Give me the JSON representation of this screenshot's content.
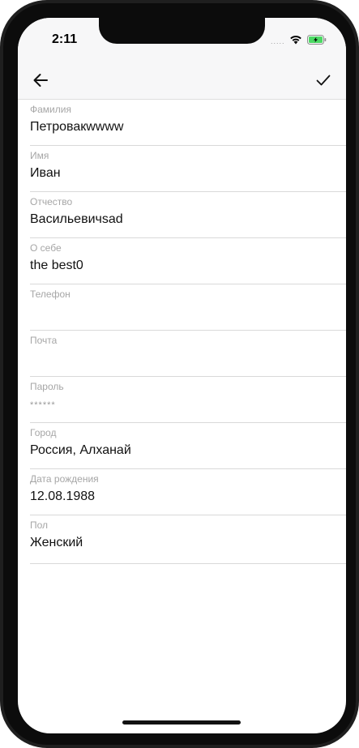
{
  "status_bar": {
    "time": "2:11",
    "signal_dots": "....."
  },
  "nav": {
    "back_icon": "arrow-left-icon",
    "confirm_icon": "checkmark-icon"
  },
  "fields": {
    "last_name": {
      "label": "Фамилия",
      "value": "Петровакwwww"
    },
    "first_name": {
      "label": "Имя",
      "value": "Иван"
    },
    "patronymic": {
      "label": "Отчество",
      "value": "Васильевичsad"
    },
    "about": {
      "label": "О себе",
      "value": "the best0"
    },
    "phone": {
      "label": "Телефон",
      "value": ""
    },
    "email": {
      "label": "Почта",
      "value": ""
    },
    "password": {
      "label": "Пароль",
      "value": "******"
    },
    "city": {
      "label": "Город",
      "value": "Россия, Алханай"
    },
    "birth_date": {
      "label": "Дата рождения",
      "value": "12.08.1988"
    },
    "gender": {
      "label": "Пол",
      "value": "Женский"
    }
  }
}
